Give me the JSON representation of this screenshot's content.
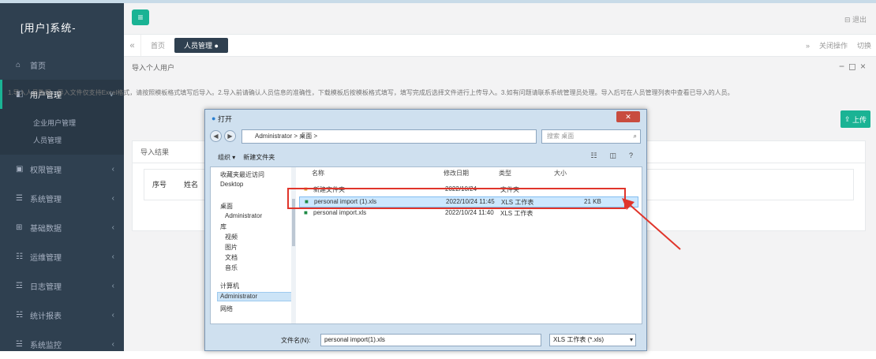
{
  "brand": "[用户]系统-",
  "sidebar": {
    "items": [
      {
        "label": "首页",
        "icon": "home-icon"
      },
      {
        "label": "用户管理",
        "icon": "users-icon",
        "active": true
      },
      {
        "label": "权限管理",
        "icon": "lock-icon"
      },
      {
        "label": "系统管理",
        "icon": "gear-icon"
      },
      {
        "label": "基础数据",
        "icon": "database-icon"
      },
      {
        "label": "运维管理",
        "icon": "wrench-icon"
      },
      {
        "label": "日志管理",
        "icon": "log-icon"
      },
      {
        "label": "统计报表",
        "icon": "chart-icon"
      },
      {
        "label": "系统监控",
        "icon": "monitor-icon"
      }
    ],
    "sub_items": [
      "企业用户管理",
      "人员管理"
    ]
  },
  "topbar": {
    "right_text": "退出"
  },
  "tabs": {
    "home": "首页",
    "active": "人员管理",
    "right": [
      "关闭操作",
      "切换"
    ]
  },
  "panel": {
    "title": "导入个人用户",
    "description": "1.导入人员数据，导入文件仅支持Excel格式，请按照模板格式填写后导入。2.导入前请确认人员信息的准确性，下载模板后按模板格式填写，填写完成后选择文件进行上传导入。3.如有问题请联系系统管理员处理。导入后可在人员管理列表中查看已导入的人员。",
    "import_button": "上传"
  },
  "content": {
    "title": "导入结果",
    "col1": "序号",
    "col2": "姓名"
  },
  "dialog": {
    "title": "打开",
    "address": "Administrator > 桌面 >",
    "search_placeholder": "搜索 桌面",
    "toolbar": [
      "组织 ▾",
      "新建文件夹"
    ],
    "tree": [
      "收藏夹最近访问",
      "Desktop",
      "桌面",
      "Administrator",
      "库",
      "视频",
      "图片",
      "文档",
      "音乐",
      "计算机",
      "Administrator",
      "网络"
    ],
    "headers": [
      "名称",
      "修改日期",
      "类型",
      "大小"
    ],
    "files": [
      {
        "name": "新建文件夹",
        "date": "2022/10/24",
        "type": "文件夹",
        "size": ""
      },
      {
        "name": "personal import (1).xls",
        "date": "2022/10/24 11:45",
        "type": "XLS 工作表",
        "size": "21 KB"
      },
      {
        "name": "personal import.xls",
        "date": "2022/10/24 11:40",
        "type": "XLS 工作表",
        "size": ""
      }
    ],
    "filename_label": "文件名(N):",
    "filename_value": "personal import(1).xls",
    "filetype_value": "XLS 工作表 (*.xls)"
  }
}
